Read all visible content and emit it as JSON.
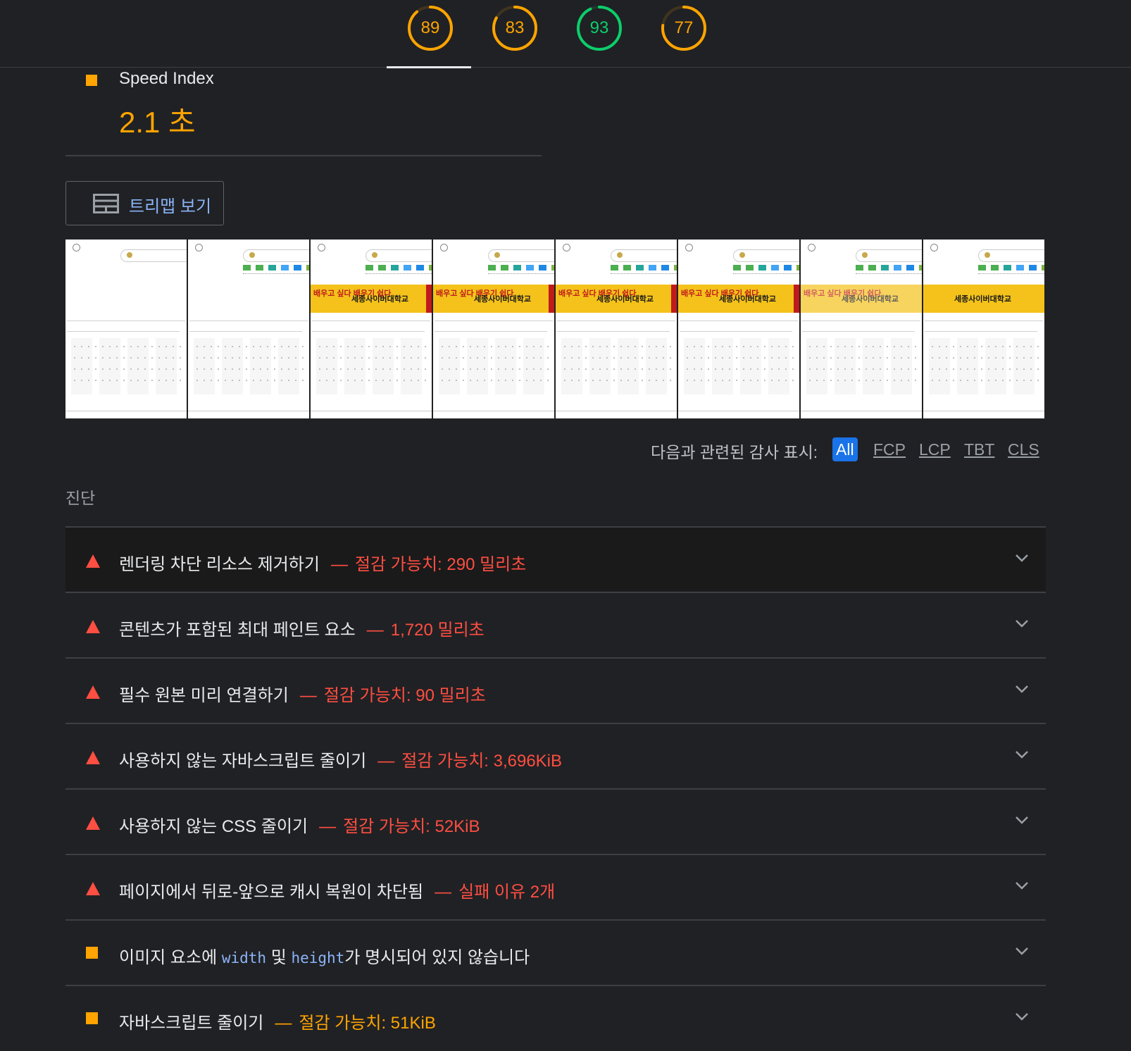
{
  "gauges": [
    {
      "score": "89",
      "color": "#ffa400",
      "fraction": 0.89
    },
    {
      "score": "83",
      "color": "#ffa400",
      "fraction": 0.83
    },
    {
      "score": "93",
      "color": "#0cce6b",
      "fraction": 0.93
    },
    {
      "score": "77",
      "color": "#ffa400",
      "fraction": 0.77
    }
  ],
  "metric": {
    "name": "Speed Index",
    "value": "2.1 초",
    "status_color": "#ffa400"
  },
  "treemap_button": {
    "label": "트리맵 보기",
    "icon": "treemap-icon"
  },
  "filmstrip": {
    "frame_count": 8,
    "banner_text_left": "배우고 싶다 배우기 쉽다",
    "banner_text_main": "세종사이버대학교"
  },
  "filter": {
    "label": "다음과 관련된 감사 표시:",
    "options": [
      "All",
      "FCP",
      "LCP",
      "TBT",
      "CLS"
    ],
    "active": "All"
  },
  "section_title": "진단",
  "audits": [
    {
      "severity": "fail",
      "title": "렌더링 차단 리소스 제거하기",
      "detail": "절감 가능치: 290 밀리초"
    },
    {
      "severity": "fail",
      "title": "콘텐츠가 포함된 최대 페인트 요소",
      "detail": "1,720 밀리초"
    },
    {
      "severity": "fail",
      "title": "필수 원본 미리 연결하기",
      "detail": "절감 가능치: 90 밀리초"
    },
    {
      "severity": "fail",
      "title": "사용하지 않는 자바스크립트 줄이기",
      "detail": "절감 가능치: 3,696KiB"
    },
    {
      "severity": "fail",
      "title": "사용하지 않는 CSS 줄이기",
      "detail": "절감 가능치: 52KiB"
    },
    {
      "severity": "fail",
      "title": "페이지에서 뒤로-앞으로 캐시 복원이 차단됨",
      "detail": "실패 이유 2개"
    },
    {
      "severity": "average",
      "title_parts": [
        "이미지 요소에 ",
        "width",
        " 및 ",
        "height",
        "가 명시되어 있지 않습니다"
      ]
    },
    {
      "severity": "average",
      "title": "자바스크립트 줄이기",
      "detail": "절감 가능치: 51KiB"
    }
  ],
  "colors": {
    "fail": "#ff4e42",
    "average": "#ffa400",
    "pass": "#0cce6b",
    "link": "#8ab4f8"
  }
}
